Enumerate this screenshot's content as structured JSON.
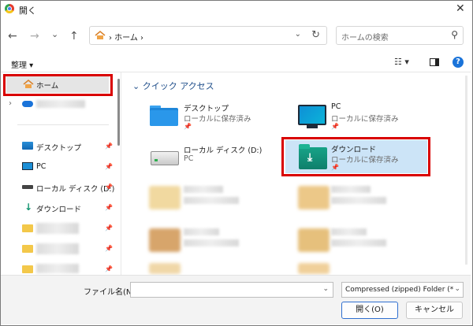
{
  "window": {
    "title": "開く",
    "close_glyph": "✕"
  },
  "nav": {
    "back": "←",
    "forward": "→",
    "recent": "⌄",
    "up": "↑",
    "address": "› ホーム ›",
    "address_dropdown": "⌄",
    "refresh": "↻"
  },
  "search": {
    "placeholder": "ホームの検索",
    "icon": "⚲"
  },
  "toolbar": {
    "organize_label": "整理 ▾",
    "view_label": "☷ ▾",
    "help": "?"
  },
  "sidebar": {
    "home_label": "ホーム",
    "items": [
      {
        "label": "デスクトップ",
        "icon": "desktop-icon"
      },
      {
        "label": "PC",
        "icon": "pc-icon"
      },
      {
        "label": "ローカル ディスク (D:)",
        "icon": "drive-icon"
      },
      {
        "label": "ダウンロード",
        "icon": "download-icon"
      }
    ],
    "pin": "📌",
    "expand": "›"
  },
  "quick_access": {
    "header": "⌄ クイック アクセス",
    "tiles": [
      {
        "title": "デスクトップ",
        "sub": "ローカルに保存済み"
      },
      {
        "title": "PC",
        "sub": "ローカルに保存済み"
      },
      {
        "title": "ローカル ディスク (D:)",
        "sub": "PC"
      },
      {
        "title": "ダウンロード",
        "sub": "ローカルに保存済み"
      }
    ]
  },
  "bottom": {
    "filename_label": "ファイル名(N):",
    "filename_value": "",
    "filetype_value": "Compressed (zipped) Folder (*.z",
    "open_label": "開く(O)",
    "cancel_label": "キャンセル"
  },
  "colors": {
    "highlight_border": "#d90000",
    "selection": "#cce4f7",
    "accent": "#1a73d9"
  }
}
